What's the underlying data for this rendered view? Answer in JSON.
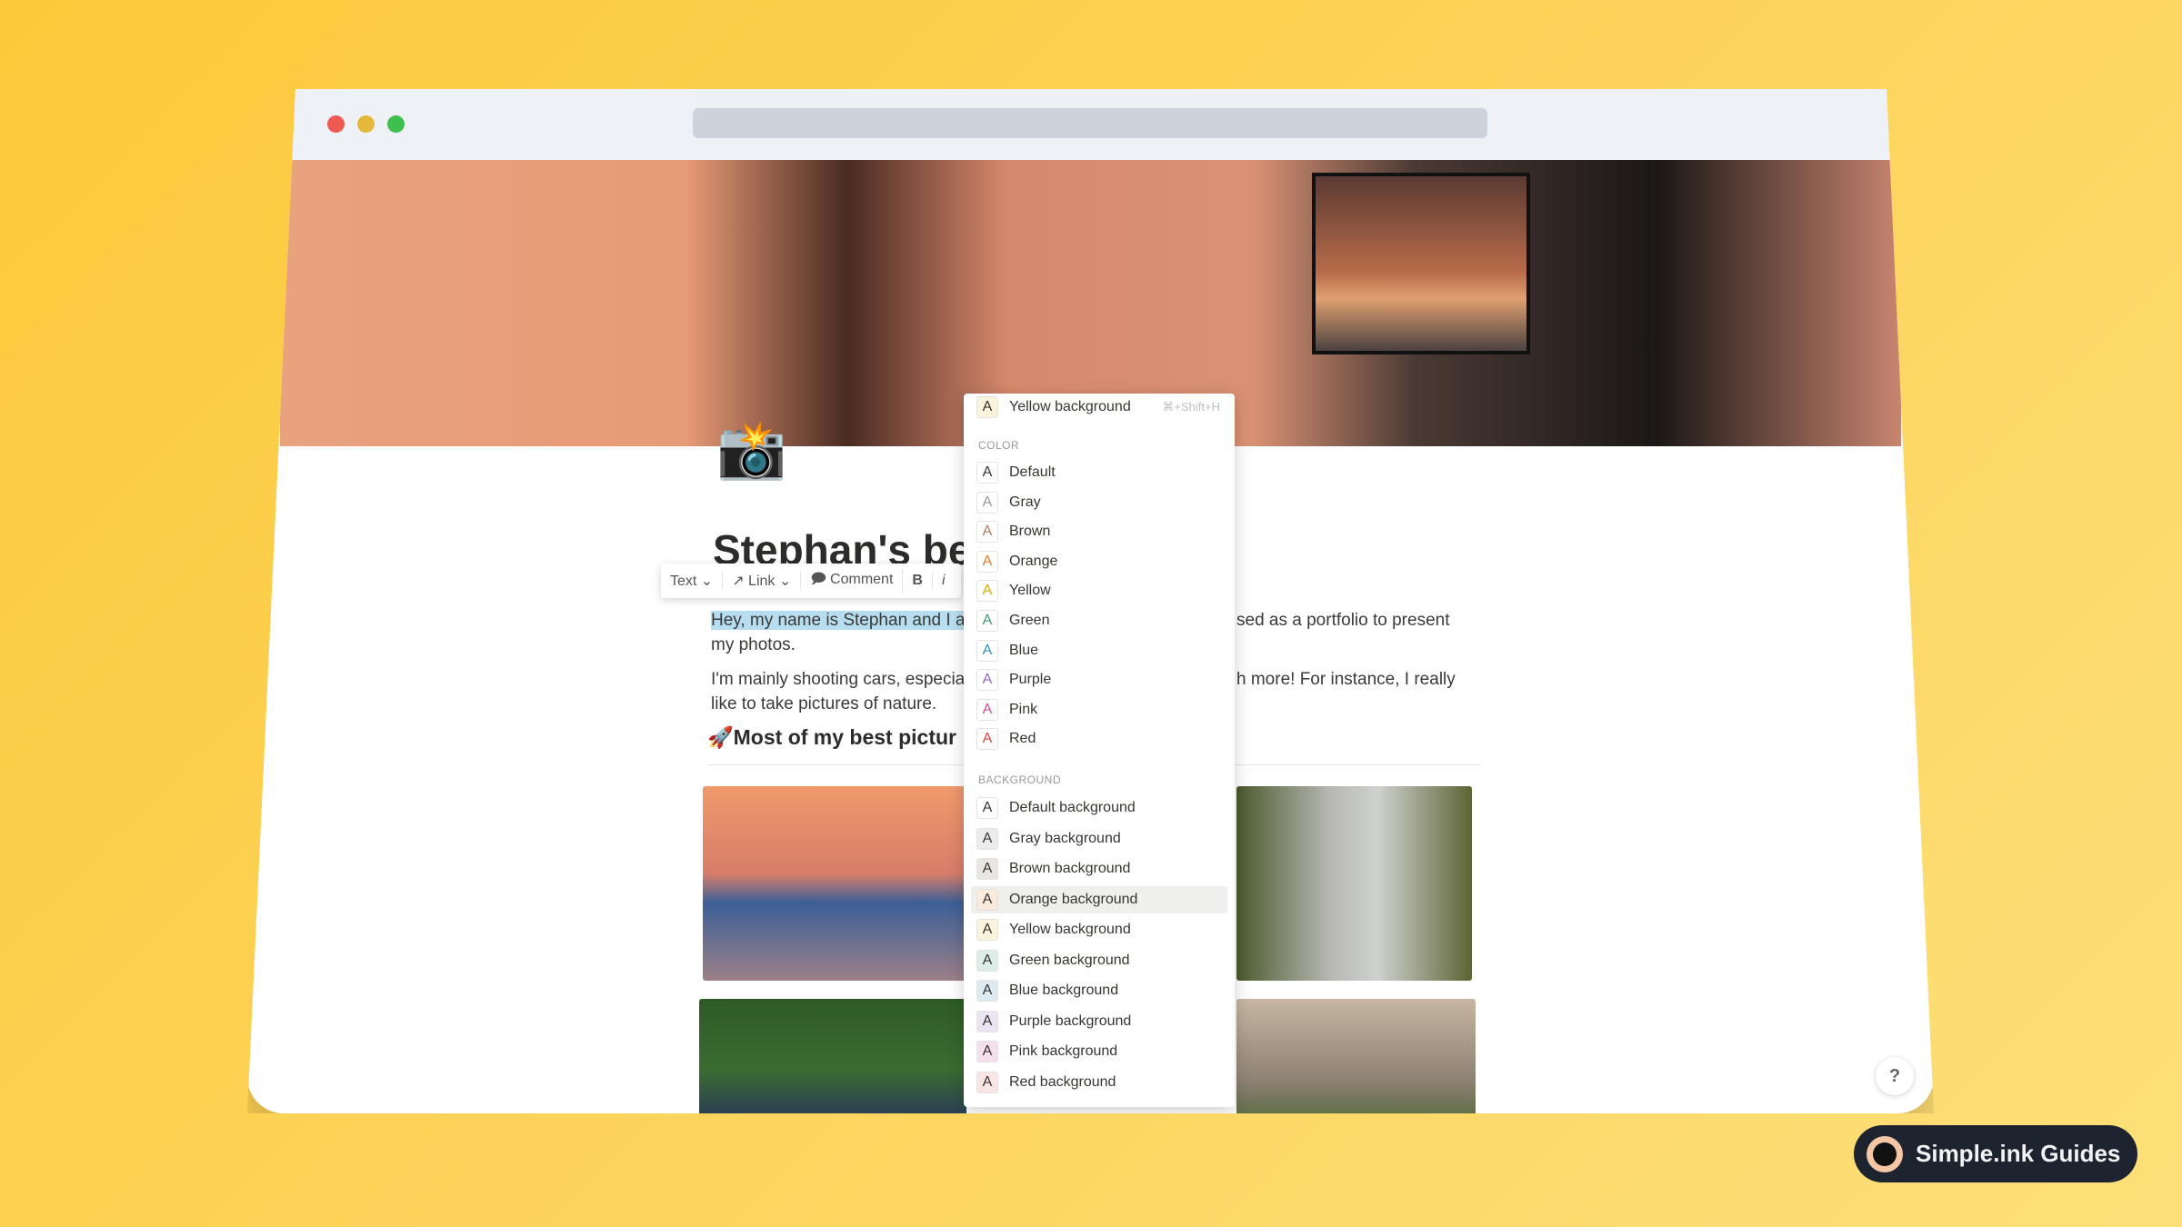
{
  "browser": {
    "traffic_lights": [
      "#ee5a52",
      "#e5b73b",
      "#3fbf4e"
    ]
  },
  "page": {
    "icon": "📸",
    "title": "Stephan's be",
    "toolbar": {
      "text": "Text ⌄",
      "link": "↗ Link ⌄",
      "comment": "Comment",
      "bold": "B",
      "italic": "i"
    },
    "para1_selected": "Hey, my name is Stephan and I a",
    "para1_right": "sed as a portfolio to present",
    "para1_line2": "my photos.",
    "para2_left": "I'm mainly shooting cars, especia",
    "para2_right": "h more! For instance, I really",
    "para2_line2": "like to take pictures of nature.",
    "heading_icon": "🚀",
    "heading": "Most of my best pictur"
  },
  "menu": {
    "last_used": {
      "label": "Yellow background",
      "shortcut": "⌘+Shift+H",
      "color": "#fbf3db"
    },
    "color_title": "COLOR",
    "colors": [
      {
        "label": "Default",
        "color": "#37352f"
      },
      {
        "label": "Gray",
        "color": "#9b9a97"
      },
      {
        "label": "Brown",
        "color": "#b07a64"
      },
      {
        "label": "Orange",
        "color": "#e0802e"
      },
      {
        "label": "Yellow",
        "color": "#dfab01"
      },
      {
        "label": "Green",
        "color": "#3f9a6f"
      },
      {
        "label": "Blue",
        "color": "#2f8fcd"
      },
      {
        "label": "Purple",
        "color": "#9a5fc9"
      },
      {
        "label": "Pink",
        "color": "#d44c9b"
      },
      {
        "label": "Red",
        "color": "#e0463e"
      }
    ],
    "background_title": "BACKGROUND",
    "backgrounds": [
      {
        "label": "Default background",
        "color": "#ffffff"
      },
      {
        "label": "Gray background",
        "color": "#ebeced"
      },
      {
        "label": "Brown background",
        "color": "#e9e5e3"
      },
      {
        "label": "Orange background",
        "color": "#faebdd",
        "hovered": true
      },
      {
        "label": "Yellow background",
        "color": "#fbf3db"
      },
      {
        "label": "Green background",
        "color": "#ddedea"
      },
      {
        "label": "Blue background",
        "color": "#ddebf1"
      },
      {
        "label": "Purple background",
        "color": "#eae4f2"
      },
      {
        "label": "Pink background",
        "color": "#f4dfeb"
      },
      {
        "label": "Red background",
        "color": "#fbe4e4"
      }
    ]
  },
  "help": "?",
  "badge": {
    "label": "Simple.ink Guides"
  }
}
